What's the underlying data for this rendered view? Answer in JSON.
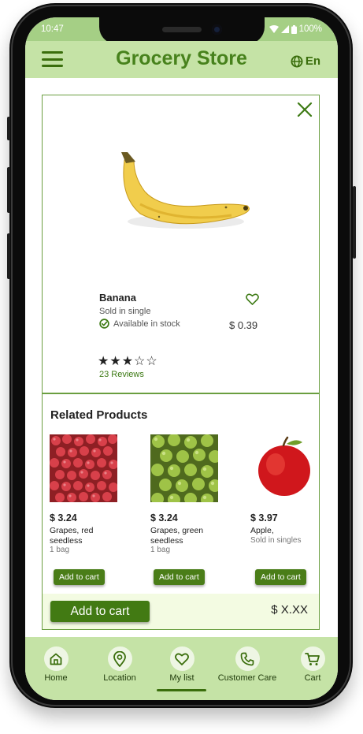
{
  "status": {
    "time": "10:47",
    "battery": "100%"
  },
  "header": {
    "title": "Grocery Store",
    "lang": "En"
  },
  "product": {
    "name": "Banana",
    "sold": "Sold in single",
    "stock": "Available in stock",
    "price": "$ 0.39",
    "stars": "★★★☆☆",
    "rating": 3,
    "rating_max": 5,
    "reviews": "23 Reviews"
  },
  "related": {
    "title": "Related Products",
    "items": [
      {
        "price": "$ 3.24",
        "name": "Grapes, red seedless",
        "meta": "1 bag",
        "button": "Add to cart"
      },
      {
        "price": "$ 3.24",
        "name": "Grapes, green seedless",
        "meta": "1 bag",
        "button": "Add to cart"
      },
      {
        "price": "$ 3.97",
        "name": "Apple,",
        "meta": "Sold in singles",
        "button": "Add to cart"
      }
    ]
  },
  "footer": {
    "add_label": "Add to cart",
    "total": "$ X.XX"
  },
  "tabs": [
    {
      "label": "Home",
      "icon": "home-icon"
    },
    {
      "label": "Location",
      "icon": "location-pin-icon"
    },
    {
      "label": "My list",
      "icon": "heart-icon",
      "active": true
    },
    {
      "label": "Customer Care",
      "icon": "phone-icon"
    },
    {
      "label": "Cart",
      "icon": "cart-icon"
    }
  ],
  "colors": {
    "brand": "#47821c",
    "header": "#c5e3a6",
    "button": "#4a7d18"
  }
}
